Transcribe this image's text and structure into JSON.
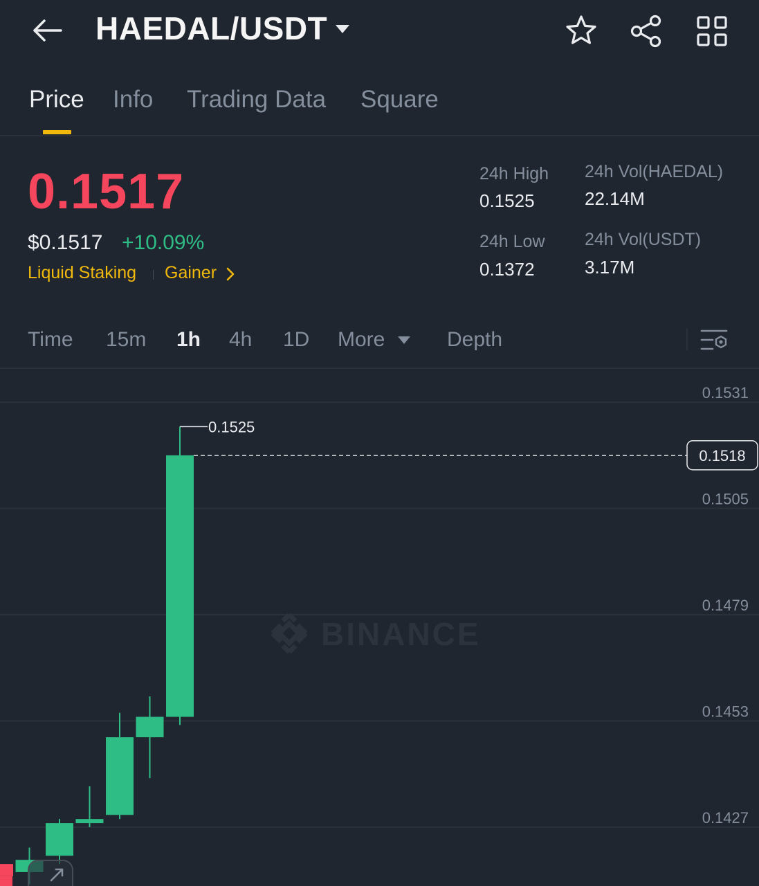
{
  "header": {
    "pair": "HAEDAL/USDT",
    "icons": [
      "back-arrow-icon",
      "caret-down-icon",
      "star-icon",
      "share-icon",
      "grid-icon"
    ]
  },
  "tabs": [
    {
      "label": "Price",
      "active": true
    },
    {
      "label": "Info",
      "active": false
    },
    {
      "label": "Trading Data",
      "active": false
    },
    {
      "label": "Square",
      "active": false
    }
  ],
  "ticker": {
    "last_price": "0.1517",
    "usd_price": "$0.1517",
    "change_pct": "+10.09%",
    "tags": [
      "Liquid Staking",
      "Gainer"
    ],
    "high_label": "24h High",
    "high_value": "0.1525",
    "low_label": "24h Low",
    "low_value": "0.1372",
    "vol_base_label": "24h Vol(HAEDAL)",
    "vol_base_value": "22.14M",
    "vol_quote_label": "24h Vol(USDT)",
    "vol_quote_value": "3.17M"
  },
  "timeframes": [
    {
      "label": "Time",
      "active": false
    },
    {
      "label": "15m",
      "active": false
    },
    {
      "label": "1h",
      "active": true
    },
    {
      "label": "4h",
      "active": false
    },
    {
      "label": "1D",
      "active": false
    },
    {
      "label": "More",
      "active": false
    },
    {
      "label": "Depth",
      "active": false
    }
  ],
  "chart_settings_icon": "chart-settings-icon",
  "colors": {
    "up": "#2ebd85",
    "down": "#f6465d",
    "accent": "#f0b90b",
    "bg": "#202630"
  },
  "chart_data": {
    "type": "candlestick",
    "interval": "1h",
    "watermark": "BINANCE",
    "y_ticks": [
      "0.1531",
      "0.1505",
      "0.1479",
      "0.1453",
      "0.1427"
    ],
    "current_price_label": "0.1518",
    "high_marker_label": "0.1525",
    "candles": [
      {
        "open": 0.1418,
        "close": 0.1415,
        "high": 0.1419,
        "low": 0.141
      },
      {
        "open": 0.1416,
        "close": 0.1419,
        "high": 0.1422,
        "low": 0.1413
      },
      {
        "open": 0.142,
        "close": 0.1428,
        "high": 0.1429,
        "low": 0.1418
      },
      {
        "open": 0.1428,
        "close": 0.1429,
        "high": 0.1437,
        "low": 0.1427
      },
      {
        "open": 0.143,
        "close": 0.1449,
        "high": 0.1455,
        "low": 0.1429
      },
      {
        "open": 0.1449,
        "close": 0.1454,
        "high": 0.1459,
        "low": 0.1439
      },
      {
        "open": 0.1454,
        "close": 0.1518,
        "high": 0.1525,
        "low": 0.1452
      }
    ]
  }
}
